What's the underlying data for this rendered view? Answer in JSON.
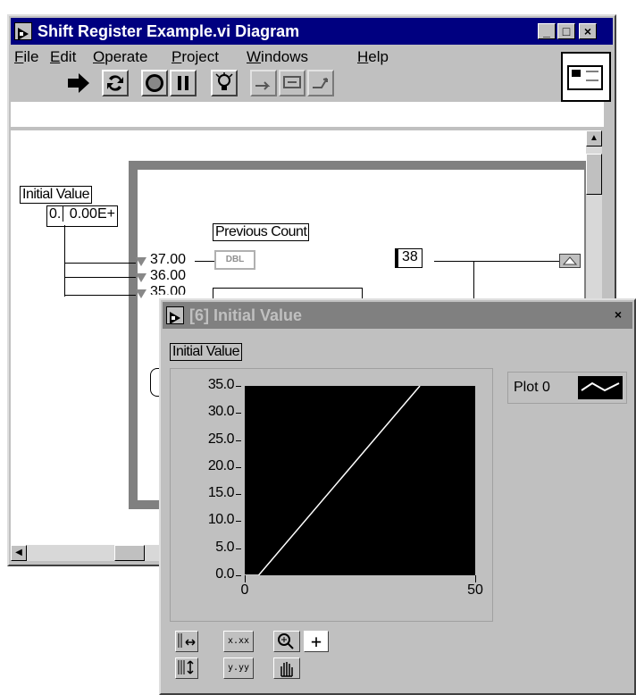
{
  "diagram_window": {
    "title": "Shift Register Example.vi Diagram",
    "menus": [
      "File",
      "Edit",
      "Operate",
      "Project",
      "Windows",
      "Help"
    ],
    "menu_underline": [
      "F",
      "E",
      "O",
      "P",
      "W",
      "H"
    ],
    "controls": {
      "minimize": "_",
      "maximize": "□",
      "close": "×"
    },
    "block_diagram": {
      "initial_value_label": "Initial Value",
      "initial_value_terminal": "0.",
      "initial_value_display": "0.00E+",
      "shift_register_values": [
        "37.00",
        "36.00",
        "35.00"
      ],
      "previous_count_label": "Previous Count",
      "dbl_terminal": "DBL",
      "count_value": "38"
    }
  },
  "chart_window": {
    "title": "[6] Initial Value",
    "close": "×",
    "chart_label": "Initial Value",
    "legend": {
      "plot_name": "Plot 0"
    },
    "chart_data": {
      "type": "line",
      "title": "Initial Value",
      "xlabel": "",
      "ylabel": "",
      "xlim": [
        0,
        50
      ],
      "ylim": [
        0,
        35
      ],
      "x_ticks": [
        "0",
        "50"
      ],
      "y_ticks": [
        "35.0",
        "30.0",
        "25.0",
        "20.0",
        "15.0",
        "10.0",
        "5.0",
        "0.0"
      ],
      "series": [
        {
          "name": "Plot 0",
          "x": [
            0,
            3,
            38
          ],
          "y": [
            0,
            0,
            35
          ]
        }
      ],
      "grid": false,
      "legend_position": "top-right"
    },
    "palette": {
      "x_format": "x.xx",
      "y_format": "y.yy",
      "crosshair": "+"
    }
  }
}
